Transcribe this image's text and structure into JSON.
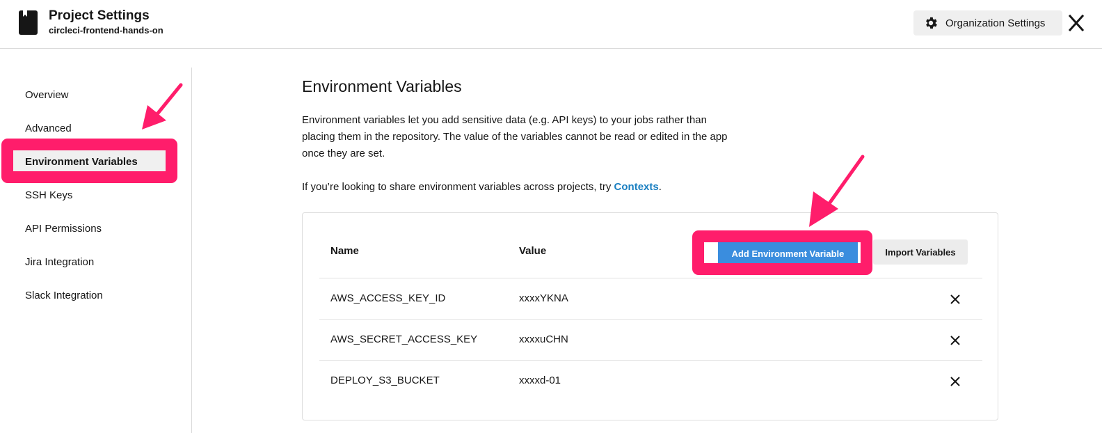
{
  "header": {
    "title": "Project Settings",
    "project_name": "circleci-frontend-hands-on",
    "org_settings_label": "Organization Settings"
  },
  "sidebar": {
    "items": [
      {
        "label": "Overview"
      },
      {
        "label": "Advanced"
      },
      {
        "label": "Environment Variables",
        "active": true
      },
      {
        "label": "SSH Keys"
      },
      {
        "label": "API Permissions"
      },
      {
        "label": "Jira Integration"
      },
      {
        "label": "Slack Integration"
      }
    ]
  },
  "main": {
    "title": "Environment Variables",
    "description": "Environment variables let you add sensitive data (e.g. API keys) to your jobs rather than placing them in the repository. The value of the variables cannot be read or edited in the app once they are set.",
    "contexts_prefix": "If you’re looking to share environment variables across projects, try ",
    "contexts_link": "Contexts",
    "contexts_suffix": "."
  },
  "table": {
    "headers": {
      "name": "Name",
      "value": "Value"
    },
    "add_button_label": "Add Environment Variable",
    "import_button_label": "Import Variables",
    "rows": [
      {
        "name": "AWS_ACCESS_KEY_ID",
        "value": "xxxxYKNA"
      },
      {
        "name": "AWS_SECRET_ACCESS_KEY",
        "value": "xxxxuCHN"
      },
      {
        "name": "DEPLOY_S3_BUCKET",
        "value": "xxxxd-01"
      }
    ]
  },
  "colors": {
    "annotation": "#ff1d6b",
    "primary_button": "#3a8dde",
    "link": "#1a7fc1"
  },
  "icons": [
    "project-book-icon",
    "gear-icon",
    "close-icon",
    "delete-x-icon"
  ]
}
